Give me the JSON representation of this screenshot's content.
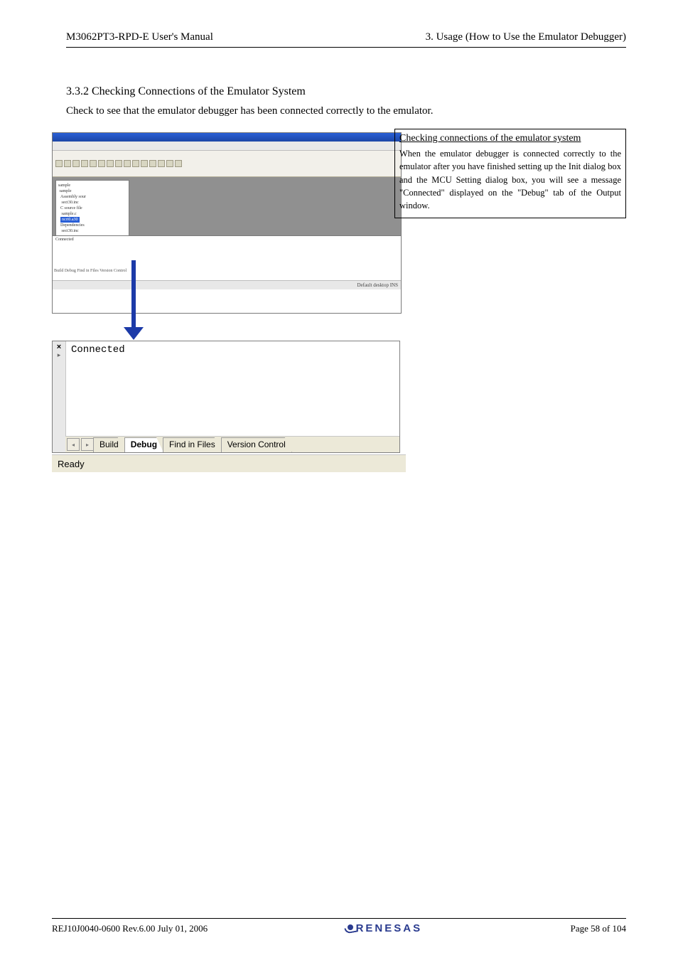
{
  "header": {
    "left": "M3062PT3-RPD-E User's Manual",
    "right": "3. Usage (How to Use the Emulator Debugger)"
  },
  "section": {
    "number_title": "3.3.2 Checking Connections of the Emulator System",
    "body": "Check to see that the emulator debugger has been connected correctly to the emulator."
  },
  "callout": {
    "title": "Checking connections of the emulator system",
    "text": "When the emulator debugger is connected correctly to the emulator after you have finished setting up the Init dialog box and the MCU Setting dialog box, you will see a message \"Connected\" displayed on the \"Debug\" tab of the Output window."
  },
  "ide": {
    "tree_sel": "ncrt0.a30",
    "out_text": "Connected",
    "bottom_tabs": "Build  Debug  Find in Files  Version Control",
    "status_left": "",
    "status_right": "Default desktop            INS"
  },
  "output_window": {
    "message": "Connected",
    "close_glyph": "×",
    "nav_prev": "◂",
    "nav_next": "▸",
    "tabs": {
      "build": "Build",
      "debug": "Debug",
      "find": "Find in Files",
      "version": "Version Control"
    }
  },
  "ready_bar": "Ready",
  "footer": {
    "left": "REJ10J0040-0600  Rev.6.00  July  01,  2006",
    "brand": "RENESAS",
    "right": "Page  58  of  104"
  }
}
